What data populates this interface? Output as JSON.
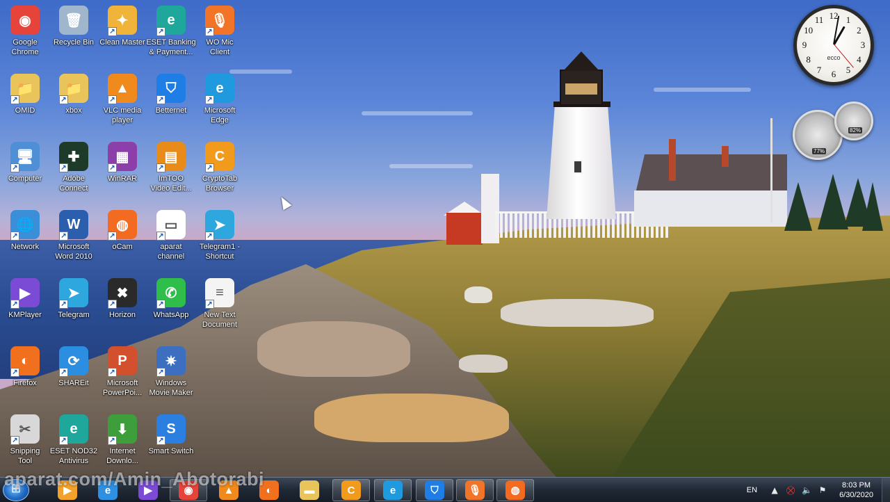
{
  "desktop": {
    "icons": [
      {
        "label": "Google\nChrome",
        "icon": "chrome-icon",
        "color": "#e6433a",
        "glyph": "◉"
      },
      {
        "label": "Recycle Bin",
        "icon": "recycle-bin-icon",
        "color": "#9fb6cc",
        "glyph": "🗑"
      },
      {
        "label": "Clean Master",
        "icon": "broom-icon",
        "color": "#f1b43a",
        "glyph": "✦"
      },
      {
        "label": "ESET Banking\n& Payment...",
        "icon": "eset-banking-icon",
        "color": "#1fa79c",
        "glyph": "e"
      },
      {
        "label": "WO Mic\nClient",
        "icon": "microphone-icon",
        "color": "#f27428",
        "glyph": "🎙"
      },
      {
        "label": "OMID",
        "icon": "user-folder-icon",
        "color": "#e9c45a",
        "glyph": "📁"
      },
      {
        "label": "xbox",
        "icon": "folder-icon",
        "color": "#e9c45a",
        "glyph": "📁"
      },
      {
        "label": "VLC media\nplayer",
        "icon": "vlc-cone-icon",
        "color": "#f08a1c",
        "glyph": "▲"
      },
      {
        "label": "Betternet",
        "icon": "shield-icon",
        "color": "#1e7ee6",
        "glyph": "⛉"
      },
      {
        "label": "Microsoft\nEdge",
        "icon": "edge-icon",
        "color": "#1f9adf",
        "glyph": "e"
      },
      {
        "label": "Computer",
        "icon": "computer-icon",
        "color": "#4f8fd6",
        "glyph": "🖥"
      },
      {
        "label": "Adobe\nConnect",
        "icon": "adobe-connect-icon",
        "color": "#1e3b2a",
        "glyph": "✚"
      },
      {
        "label": "WinRAR",
        "icon": "winrar-icon",
        "color": "#8c3fa8",
        "glyph": "▦"
      },
      {
        "label": "ImTOO\nVideo Edit...",
        "icon": "video-editor-icon",
        "color": "#e88b18",
        "glyph": "▤"
      },
      {
        "label": "CryptoTab\nBrowser",
        "icon": "cryptotab-icon",
        "color": "#f29a1c",
        "glyph": "C"
      },
      {
        "label": "Network",
        "icon": "network-globe-icon",
        "color": "#3a8fd8",
        "glyph": "🌐"
      },
      {
        "label": "Microsoft\nWord 2010",
        "icon": "word-icon",
        "color": "#2b5fae",
        "glyph": "W"
      },
      {
        "label": "oCam",
        "icon": "ocam-icon",
        "color": "#f36b21",
        "glyph": "◍"
      },
      {
        "label": "aparat\nchannel",
        "icon": "document-thumbnail-icon",
        "color": "#ffffff",
        "glyph": "▭"
      },
      {
        "label": "Telegram1 -\nShortcut",
        "icon": "telegram-icon",
        "color": "#2ea6de",
        "glyph": "➤"
      },
      {
        "label": "KMPlayer",
        "icon": "kmplayer-icon",
        "color": "#7b4bd6",
        "glyph": "▶"
      },
      {
        "label": "Telegram",
        "icon": "telegram-icon",
        "color": "#2ea6de",
        "glyph": "➤"
      },
      {
        "label": "Horizon",
        "icon": "xbox-horizon-icon",
        "color": "#2a2a2a",
        "glyph": "✖"
      },
      {
        "label": "WhatsApp",
        "icon": "whatsapp-icon",
        "color": "#2fbe4a",
        "glyph": "✆"
      },
      {
        "label": "New Text\nDocument",
        "icon": "text-document-icon",
        "color": "#f4f4f4",
        "glyph": "≡"
      },
      {
        "label": "Firefox",
        "icon": "firefox-icon",
        "color": "#f0701e",
        "glyph": "◐"
      },
      {
        "label": "SHAREit",
        "icon": "shareit-icon",
        "color": "#2b8ee0",
        "glyph": "⟳"
      },
      {
        "label": "Microsoft\nPowerPoi...",
        "icon": "powerpoint-icon",
        "color": "#d2502d",
        "glyph": "P"
      },
      {
        "label": "Windows\nMovie Maker",
        "icon": "movie-maker-icon",
        "color": "#3c6fbf",
        "glyph": "✷"
      },
      {
        "label": "",
        "icon": "",
        "color": "",
        "glyph": ""
      },
      {
        "label": "Snipping\nTool",
        "icon": "scissors-icon",
        "color": "#d8d8d8",
        "glyph": "✂"
      },
      {
        "label": "ESET NOD32\nAntivirus",
        "icon": "eset-nod32-icon",
        "color": "#1fa79c",
        "glyph": "e"
      },
      {
        "label": "Internet\nDownlo...",
        "icon": "download-manager-icon",
        "color": "#3e9e3c",
        "glyph": "⬇"
      },
      {
        "label": "Smart Switch",
        "icon": "smart-switch-icon",
        "color": "#2a7fe0",
        "glyph": "S"
      }
    ]
  },
  "gadgets": {
    "clock": {
      "brand": "ecco",
      "numbers": [
        "12",
        "1",
        "2",
        "3",
        "4",
        "5",
        "6",
        "7",
        "8",
        "9",
        "10",
        "11"
      ]
    },
    "cpu_meter": {
      "cpu_percent": "77%",
      "memory_percent": "82%"
    }
  },
  "taskbar": {
    "buttons": [
      {
        "icon": "media-player-icon",
        "color": "#f2a12a",
        "glyph": "▶",
        "active": false
      },
      {
        "icon": "internet-explorer-icon",
        "color": "#2f8fe0",
        "glyph": "e",
        "active": false
      },
      {
        "icon": "kmplayer-icon",
        "color": "#7b4bd6",
        "glyph": "▶",
        "active": false
      },
      {
        "icon": "chrome-icon",
        "color": "#e6433a",
        "glyph": "◉",
        "active": true
      },
      {
        "icon": "vlc-cone-icon",
        "color": "#f08a1c",
        "glyph": "▲",
        "active": false
      },
      {
        "icon": "firefox-icon",
        "color": "#f0701e",
        "glyph": "◐",
        "active": false
      },
      {
        "icon": "file-explorer-icon",
        "color": "#e9c45a",
        "glyph": "▬",
        "active": false
      },
      {
        "icon": "cryptotab-icon",
        "color": "#f29a1c",
        "glyph": "C",
        "active": true
      },
      {
        "icon": "edge-icon",
        "color": "#1f9adf",
        "glyph": "e",
        "active": true
      },
      {
        "icon": "shield-icon",
        "color": "#1e7ee6",
        "glyph": "⛉",
        "active": true
      },
      {
        "icon": "microphone-icon",
        "color": "#f27428",
        "glyph": "🎙",
        "active": true
      },
      {
        "icon": "ocam-icon",
        "color": "#f36b21",
        "glyph": "◍",
        "active": true
      }
    ],
    "tray": {
      "language": "EN",
      "time": "8:03 PM",
      "date": "6/30/2020"
    }
  },
  "watermark": "aparat.com/Amin_Abotorabi"
}
